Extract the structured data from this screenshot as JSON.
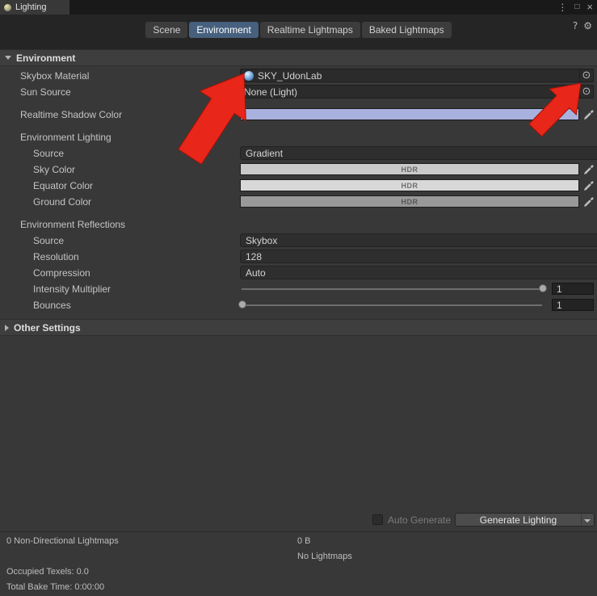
{
  "window": {
    "title": "Lighting"
  },
  "icons": {
    "kebab": "⋮",
    "maximize": "□",
    "close": "×",
    "help": "?",
    "gear": "⚙",
    "object_picker": "⊙"
  },
  "toolbar": {
    "tabs": [
      {
        "label": "Scene"
      },
      {
        "label": "Environment"
      },
      {
        "label": "Realtime Lightmaps"
      },
      {
        "label": "Baked Lightmaps"
      }
    ]
  },
  "sections": {
    "environment": "Environment",
    "other_settings": "Other Settings"
  },
  "environment": {
    "skybox_material": {
      "label": "Skybox Material",
      "value": "SKY_UdonLab"
    },
    "sun_source": {
      "label": "Sun Source",
      "value": "None (Light)"
    },
    "realtime_shadow_color": {
      "label": "Realtime Shadow Color",
      "color": "#a9b1de"
    },
    "lighting": {
      "label": "Environment Lighting",
      "source": {
        "label": "Source",
        "value": "Gradient"
      },
      "sky_color": {
        "label": "Sky Color",
        "badge": "HDR",
        "color": "#c9c9c9"
      },
      "equator_color": {
        "label": "Equator Color",
        "badge": "HDR",
        "color": "#d8d8d8"
      },
      "ground_color": {
        "label": "Ground Color",
        "badge": "HDR",
        "color": "#999999"
      }
    },
    "reflections": {
      "label": "Environment Reflections",
      "source": {
        "label": "Source",
        "value": "Skybox"
      },
      "resolution": {
        "label": "Resolution",
        "value": "128"
      },
      "compression": {
        "label": "Compression",
        "value": "Auto"
      },
      "intensity_multiplier": {
        "label": "Intensity Multiplier",
        "value": "1"
      },
      "bounces": {
        "label": "Bounces",
        "value": "1"
      }
    }
  },
  "footer": {
    "auto_generate": "Auto Generate",
    "generate_lighting": "Generate Lighting"
  },
  "status": {
    "lightmaps_count": "0 Non-Directional Lightmaps",
    "size": "0 B",
    "lightmaps_state": "No Lightmaps",
    "occupied_texels": "Occupied Texels: 0.0",
    "total_bake_time": "Total Bake Time: 0:00:00"
  },
  "colors": {
    "active_tab": "#46607e",
    "arrow": "#e8261a"
  }
}
